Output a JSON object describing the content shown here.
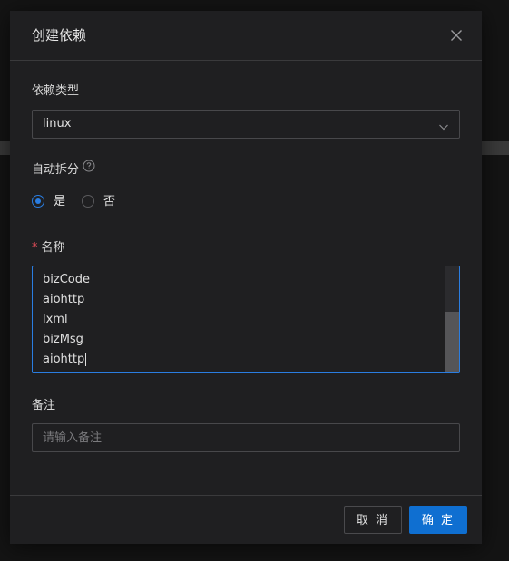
{
  "modal": {
    "title": "创建依赖",
    "close_icon": "close-icon"
  },
  "form": {
    "dependency_type": {
      "label": "依赖类型",
      "value": "linux",
      "icon": "chevron-down-icon"
    },
    "auto_split": {
      "label": "自动拆分",
      "help_icon": "question-circle-icon",
      "options": [
        {
          "label": "是",
          "checked": true
        },
        {
          "label": "否",
          "checked": false
        }
      ]
    },
    "name": {
      "required_mark": "*",
      "label": "名称",
      "lines": [
        "bizCode",
        "aiohttp",
        "lxml",
        "bizMsg",
        "aiohttp"
      ]
    },
    "remark": {
      "label": "备注",
      "placeholder": "请输入备注",
      "value": ""
    }
  },
  "footer": {
    "cancel_label": "取 消",
    "ok_label": "确 定"
  },
  "colors": {
    "accent": "#2a7de1",
    "primary_button": "#0f6fd1",
    "required": "#e34d59",
    "modal_bg": "#1f1f21"
  }
}
